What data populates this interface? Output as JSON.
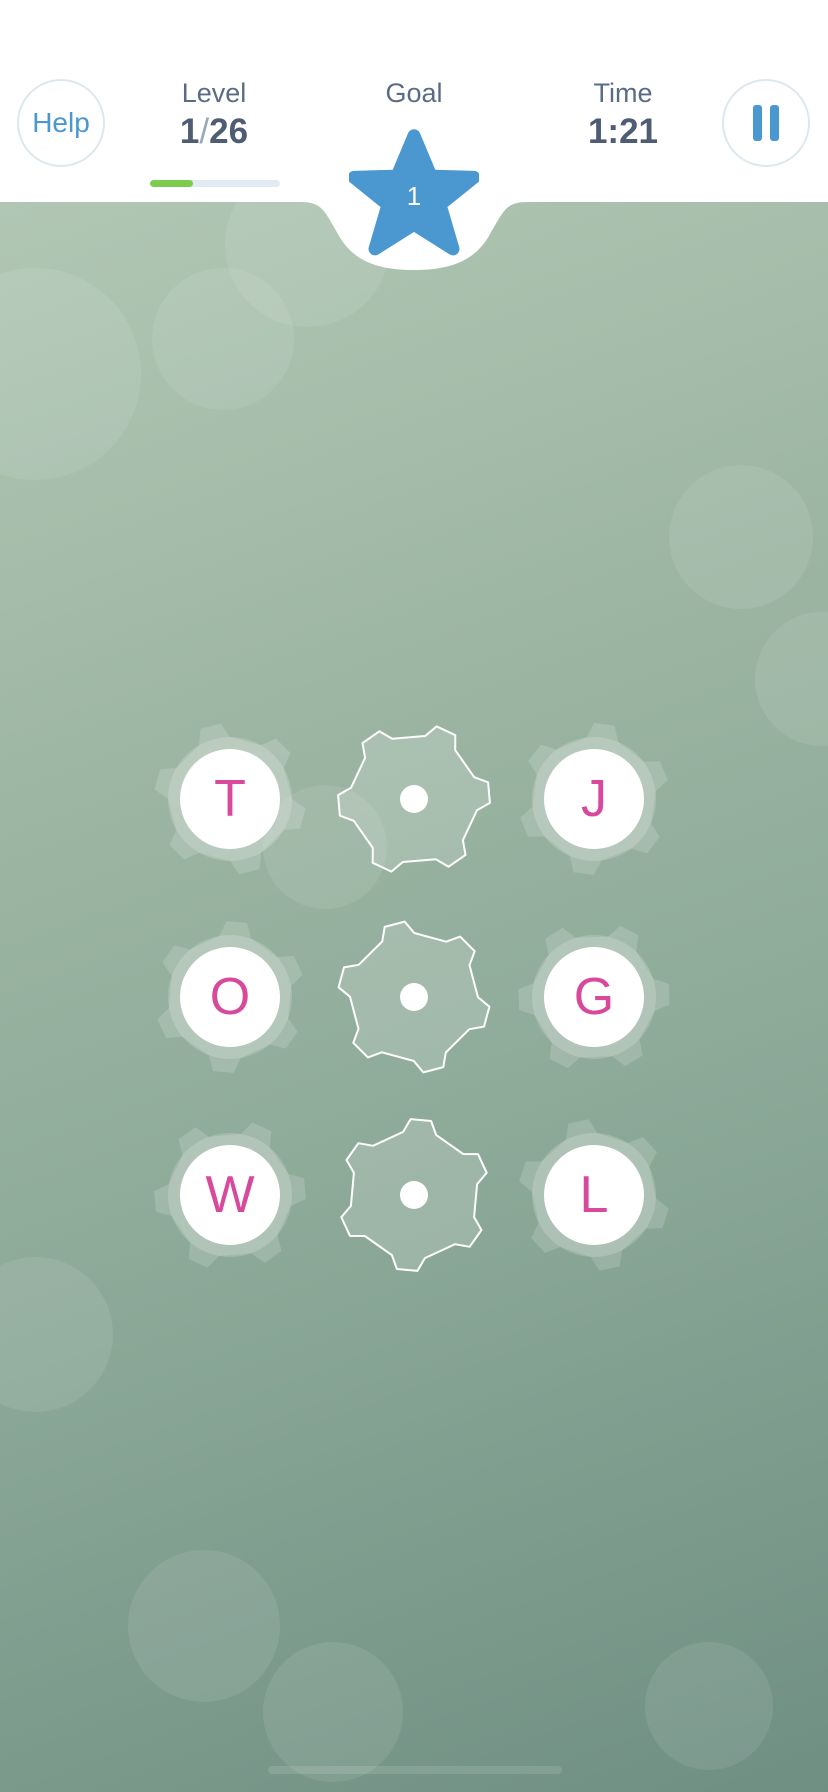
{
  "header": {
    "help_label": "Help",
    "level_label": "Level",
    "level_current": "1",
    "level_separator": "/",
    "level_total": "26",
    "level_progress": 0.33,
    "goal_label": "Goal",
    "goal_value": "1",
    "time_label": "Time",
    "time_value": "1:21",
    "pause_icon": "pause-icon"
  },
  "board": {
    "rows": [
      [
        "T",
        "",
        "J"
      ],
      [
        "O",
        "",
        "G"
      ],
      [
        "W",
        "",
        "L"
      ]
    ]
  },
  "colors": {
    "accent_blue": "#4a98cf",
    "letter_pink": "#d9499b",
    "progress_green": "#7ccc4d"
  }
}
